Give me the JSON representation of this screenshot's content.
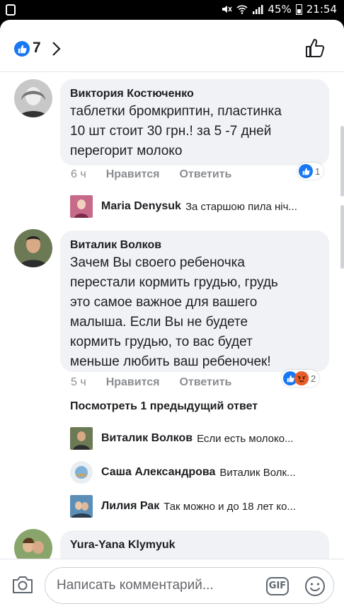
{
  "status_bar": {
    "battery": "45%",
    "time": "21:54"
  },
  "header": {
    "like_count": "7"
  },
  "comments": [
    {
      "author": "Виктория Костюченко",
      "lines": [
        "таблетки бромкриптин, пластинка",
        "10 шт стоит 30 грн.! за 5 -7 дней",
        "перегорит молоко"
      ],
      "time": "6 ч",
      "like_label": "Нравится",
      "reply_label": "Ответить",
      "reactions_count": "1",
      "replies": [
        {
          "name": "Maria Denysuk",
          "text": "За старшою пила ніч..."
        }
      ]
    },
    {
      "author": "Виталик Волков",
      "lines": [
        "Зачем Вы своего ребеночка",
        "перестали кормить грудью, грудь",
        "это самое важное для вашего",
        "малыша. Если Вы не будете",
        "кормить грудью, то вас будет",
        "меньше любить ваш ребеночек!"
      ],
      "time": "5 ч",
      "like_label": "Нравится",
      "reply_label": "Ответить",
      "reactions_count": "2",
      "more_replies": "Посмотреть 1 предыдущий ответ",
      "replies": [
        {
          "name": "Виталик Волков",
          "text": "Если есть молоко..."
        },
        {
          "name": "Саша Александрова",
          "text": "Виталик Волк..."
        },
        {
          "name": "Лилия Рак",
          "text": "Так можно и до 18 лет ко..."
        }
      ]
    },
    {
      "author": "Yura-Yana Klymyuk"
    }
  ],
  "composer": {
    "placeholder": "Написать комментарий...",
    "gif": "GIF"
  },
  "colors": {
    "accent": "#1877f2",
    "bubble": "#f0f2f5",
    "muted": "#8a8d91"
  }
}
